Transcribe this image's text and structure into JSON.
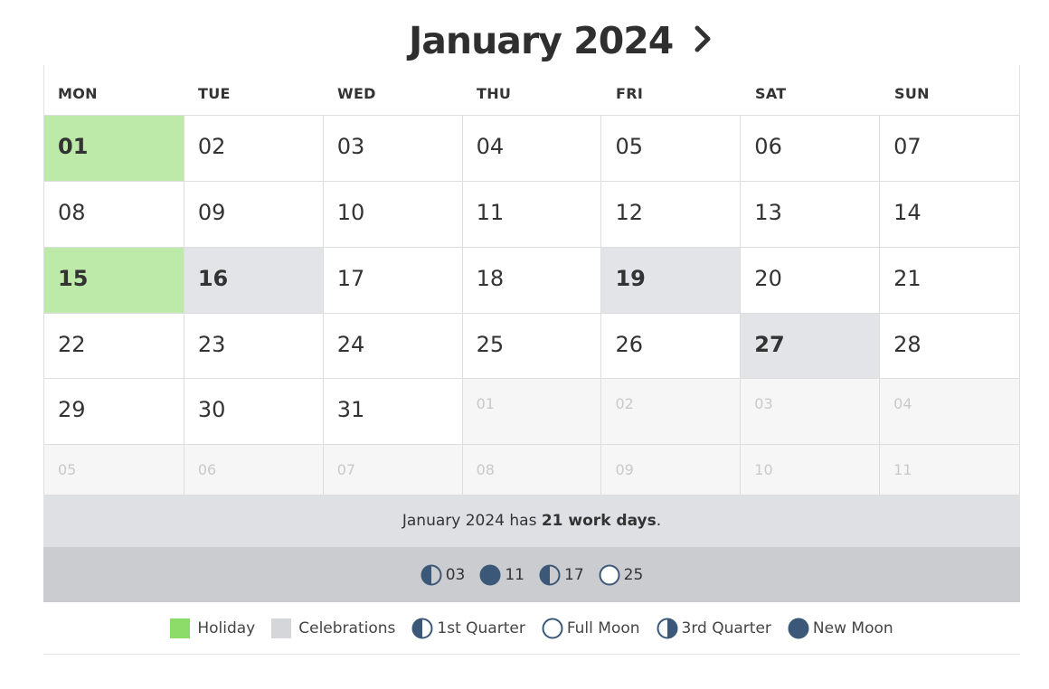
{
  "header": {
    "title": "January 2024",
    "next_icon": "chevron-right-icon"
  },
  "weekdays": [
    "MON",
    "TUE",
    "WED",
    "THU",
    "FRI",
    "SAT",
    "SUN"
  ],
  "weeks": [
    [
      {
        "d": "01",
        "t": "holiday"
      },
      {
        "d": "02",
        "t": "normal"
      },
      {
        "d": "03",
        "t": "normal"
      },
      {
        "d": "04",
        "t": "normal"
      },
      {
        "d": "05",
        "t": "normal"
      },
      {
        "d": "06",
        "t": "normal"
      },
      {
        "d": "07",
        "t": "normal"
      }
    ],
    [
      {
        "d": "08",
        "t": "normal"
      },
      {
        "d": "09",
        "t": "normal"
      },
      {
        "d": "10",
        "t": "normal"
      },
      {
        "d": "11",
        "t": "normal"
      },
      {
        "d": "12",
        "t": "normal"
      },
      {
        "d": "13",
        "t": "normal"
      },
      {
        "d": "14",
        "t": "normal"
      }
    ],
    [
      {
        "d": "15",
        "t": "holiday"
      },
      {
        "d": "16",
        "t": "celebration"
      },
      {
        "d": "17",
        "t": "normal"
      },
      {
        "d": "18",
        "t": "normal"
      },
      {
        "d": "19",
        "t": "celebration"
      },
      {
        "d": "20",
        "t": "normal"
      },
      {
        "d": "21",
        "t": "normal"
      }
    ],
    [
      {
        "d": "22",
        "t": "normal"
      },
      {
        "d": "23",
        "t": "normal"
      },
      {
        "d": "24",
        "t": "normal"
      },
      {
        "d": "25",
        "t": "normal"
      },
      {
        "d": "26",
        "t": "normal"
      },
      {
        "d": "27",
        "t": "celebration"
      },
      {
        "d": "28",
        "t": "normal"
      }
    ],
    [
      {
        "d": "29",
        "t": "normal"
      },
      {
        "d": "30",
        "t": "normal"
      },
      {
        "d": "31",
        "t": "normal"
      },
      {
        "d": "01",
        "t": "other"
      },
      {
        "d": "02",
        "t": "other"
      },
      {
        "d": "03",
        "t": "other"
      },
      {
        "d": "04",
        "t": "other"
      }
    ],
    [
      {
        "d": "05",
        "t": "other"
      },
      {
        "d": "06",
        "t": "other"
      },
      {
        "d": "07",
        "t": "other"
      },
      {
        "d": "08",
        "t": "other"
      },
      {
        "d": "09",
        "t": "other"
      },
      {
        "d": "10",
        "t": "other"
      },
      {
        "d": "11",
        "t": "other"
      }
    ]
  ],
  "summary": {
    "prefix": "January 2024 has ",
    "count": "21 work days",
    "suffix": "."
  },
  "moon_phases": [
    {
      "icon": "first-quarter",
      "day": "03"
    },
    {
      "icon": "new-moon",
      "day": "11"
    },
    {
      "icon": "first-quarter",
      "day": "17"
    },
    {
      "icon": "full-moon",
      "day": "25"
    }
  ],
  "legend": [
    {
      "kind": "swatch",
      "color": "#8ddc6a",
      "label": "Holiday"
    },
    {
      "kind": "swatch",
      "color": "#d5d6da",
      "label": "Celebrations"
    },
    {
      "kind": "first-quarter",
      "label": "1st Quarter"
    },
    {
      "kind": "full-moon",
      "label": "Full Moon"
    },
    {
      "kind": "third-quarter",
      "label": "3rd Quarter"
    },
    {
      "kind": "new-moon",
      "label": "New Moon"
    }
  ],
  "colors": {
    "holiday_bg": "#bdeaa8",
    "celebration_bg": "#e3e4e8",
    "moon": "#3b5878"
  }
}
